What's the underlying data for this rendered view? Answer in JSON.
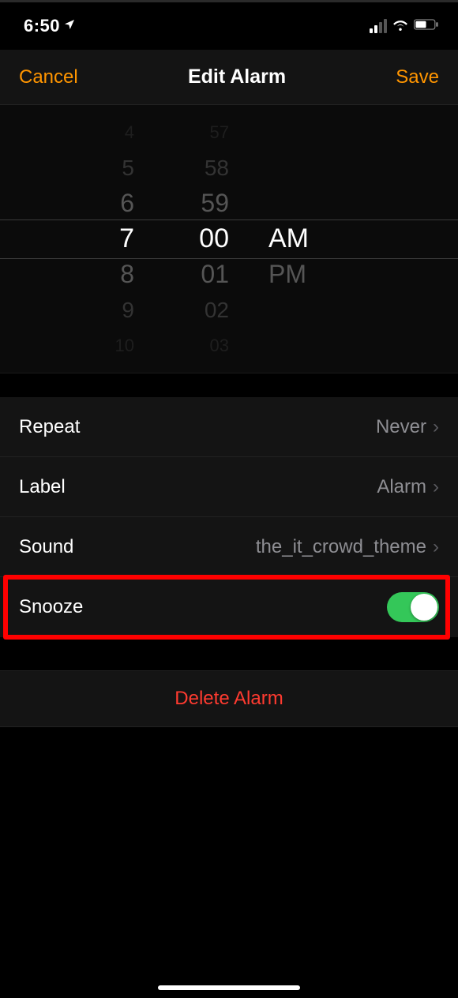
{
  "status": {
    "time": "6:50"
  },
  "nav": {
    "cancel": "Cancel",
    "title": "Edit Alarm",
    "save": "Save"
  },
  "picker": {
    "hours": [
      "4",
      "5",
      "6",
      "7",
      "8",
      "9",
      "10"
    ],
    "minutes": [
      "57",
      "58",
      "59",
      "00",
      "01",
      "02",
      "03"
    ],
    "ampm": [
      "AM",
      "PM"
    ]
  },
  "rows": {
    "repeat": {
      "label": "Repeat",
      "value": "Never"
    },
    "label": {
      "label": "Label",
      "value": "Alarm"
    },
    "sound": {
      "label": "Sound",
      "value": "the_it_crowd_theme"
    },
    "snooze": {
      "label": "Snooze",
      "on": true
    }
  },
  "delete_label": "Delete Alarm",
  "highlight_row": "snooze"
}
